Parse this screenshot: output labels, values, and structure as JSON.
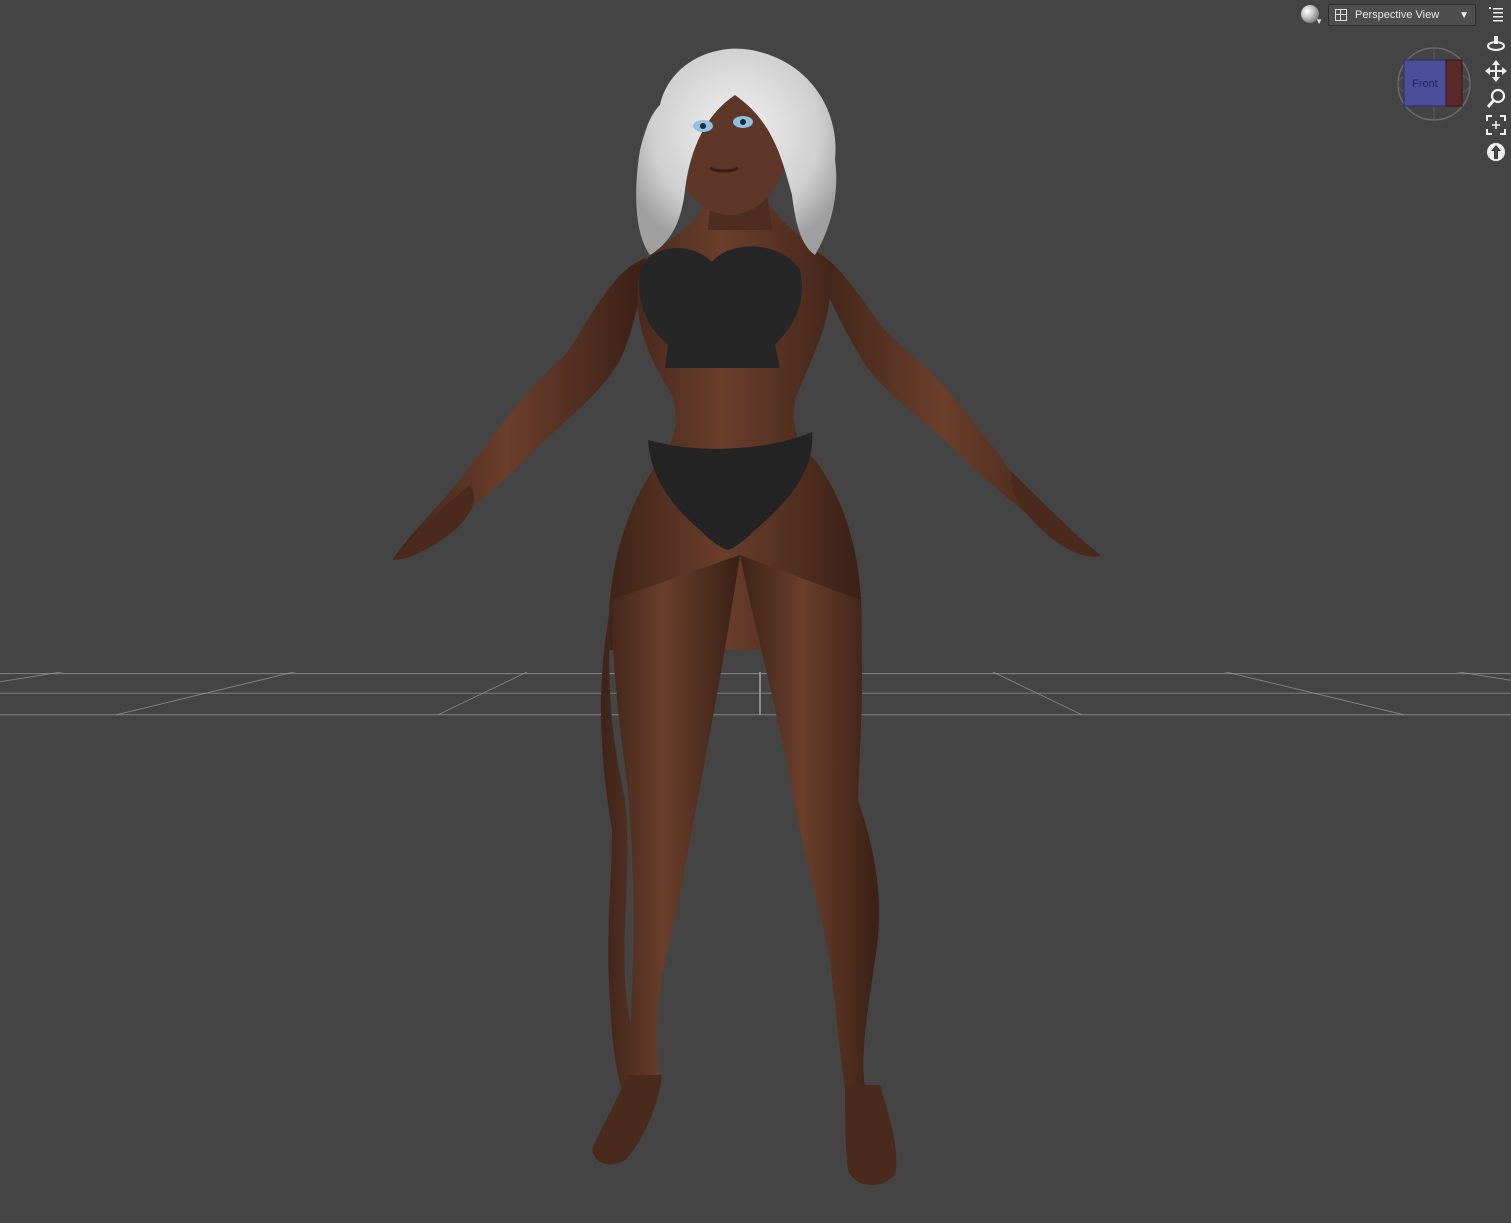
{
  "toolbar": {
    "view_name": "Perspective View",
    "render_icon": "draw-style-sphere-icon",
    "layout_icon": "viewport-layout-icon",
    "dropdown_icon": "chevron-down-icon",
    "menu_icon": "viewport-menu-icon"
  },
  "view_cube": {
    "face_label": "Front"
  },
  "camera_tools": [
    {
      "name": "orbit-icon"
    },
    {
      "name": "pan-icon"
    },
    {
      "name": "zoom-icon"
    },
    {
      "name": "frame-icon"
    },
    {
      "name": "reset-view-icon"
    }
  ],
  "colors": {
    "background": "#444444",
    "grid_line": "#9a9a9a",
    "grid_axis": "#d8d8d8",
    "skin": "#5a3424",
    "hair": "#dcdcdc",
    "lingerie": "#242424",
    "cube_front": "#4b4e9a",
    "cube_side": "#5a2a2a"
  }
}
